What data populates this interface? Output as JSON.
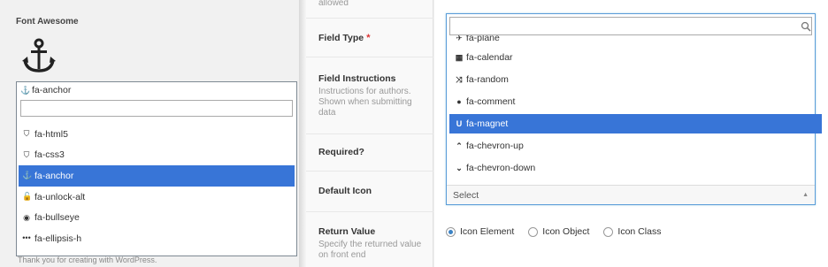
{
  "left": {
    "title": "Font Awesome",
    "selected_value": "fa-anchor",
    "search_value": "",
    "options": [
      {
        "icon": "html5-icon",
        "glyph": "⛉",
        "label": "fa-html5",
        "selected": false
      },
      {
        "icon": "css3-icon",
        "glyph": "⛉",
        "label": "fa-css3",
        "selected": false
      },
      {
        "icon": "anchor-icon",
        "glyph": "⚓",
        "label": "fa-anchor",
        "selected": true
      },
      {
        "icon": "unlock-alt-icon",
        "glyph": "🔓",
        "label": "fa-unlock-alt",
        "selected": false
      },
      {
        "icon": "bullseye-icon",
        "glyph": "◉",
        "label": "fa-bullseye",
        "selected": false
      },
      {
        "icon": "ellipsis-h-icon",
        "glyph": "•••",
        "label": "fa-ellipsis-h",
        "selected": false
      }
    ],
    "footer_text": "Thank you for creating with WordPress."
  },
  "labels": {
    "allowed_text": "allowed",
    "field_type": "Field Type",
    "required_mark": "*",
    "field_instructions": "Field Instructions",
    "field_instructions_desc": "Instructions for authors. Shown when submitting data",
    "required": "Required?",
    "default_icon": "Default Icon",
    "return_value": "Return Value",
    "return_value_desc": "Specify the returned value on front end"
  },
  "dropdown": {
    "search_value": "",
    "partial_option": "fa-plane",
    "options": [
      {
        "icon": "calendar-icon",
        "glyph": "▦",
        "label": "fa-calendar",
        "selected": false
      },
      {
        "icon": "random-icon",
        "glyph": "⤨",
        "label": "fa-random",
        "selected": false
      },
      {
        "icon": "comment-icon",
        "glyph": "●",
        "label": "fa-comment",
        "selected": false
      },
      {
        "icon": "magnet-icon",
        "glyph": "U",
        "label": "fa-magnet",
        "selected": true
      },
      {
        "icon": "chevron-up-icon",
        "glyph": "⌃",
        "label": "fa-chevron-up",
        "selected": false
      },
      {
        "icon": "chevron-down-icon",
        "glyph": "⌄",
        "label": "fa-chevron-down",
        "selected": false
      }
    ],
    "select_value": "Select"
  },
  "return_value": {
    "options": [
      {
        "label": "Icon Element",
        "checked": true
      },
      {
        "label": "Icon Object",
        "checked": false
      },
      {
        "label": "Icon Class",
        "checked": false
      }
    ]
  },
  "colors": {
    "selected_bg": "#3875d7",
    "focus_border": "#5b9dd9",
    "required_red": "#dc3232"
  }
}
